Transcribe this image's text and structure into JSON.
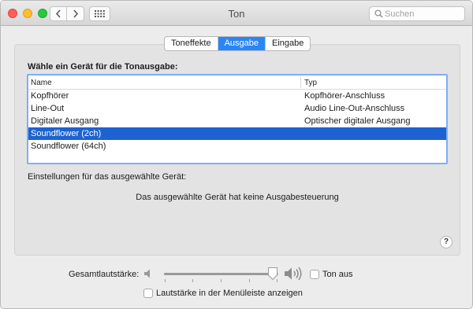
{
  "window": {
    "title": "Ton"
  },
  "search": {
    "placeholder": "Suchen"
  },
  "tabs": [
    {
      "label": "Toneffekte",
      "active": false
    },
    {
      "label": "Ausgabe",
      "active": true
    },
    {
      "label": "Eingabe",
      "active": false
    }
  ],
  "output": {
    "heading": "Wähle ein Gerät für die Tonausgabe:",
    "columns": {
      "name": "Name",
      "type": "Typ"
    },
    "devices": [
      {
        "name": "Kopfhörer",
        "type": "Kopfhörer-Anschluss",
        "selected": false
      },
      {
        "name": "Line-Out",
        "type": "Audio Line-Out-Anschluss",
        "selected": false
      },
      {
        "name": "Digitaler Ausgang",
        "type": "Optischer digitaler Ausgang",
        "selected": false
      },
      {
        "name": "Soundflower (2ch)",
        "type": "",
        "selected": true
      },
      {
        "name": "Soundflower (64ch)",
        "type": "",
        "selected": false
      }
    ],
    "settings_label": "Einstellungen für das ausgewählte Gerät:",
    "no_control_message": "Das ausgewählte Gerät hat keine Ausgabesteuerung"
  },
  "help": {
    "label": "?"
  },
  "volume": {
    "label": "Gesamtlautstärke:",
    "level_fraction": 0.95,
    "mute_label": "Ton aus",
    "mute_checked": false,
    "menubar_label": "Lautstärke in der Menüleiste anzeigen",
    "menubar_checked": false
  },
  "colors": {
    "accent": "#2a86f7",
    "selection": "#1d62d0",
    "close": "#fe5f57",
    "minimize": "#febc2e",
    "maximize": "#28c840"
  }
}
